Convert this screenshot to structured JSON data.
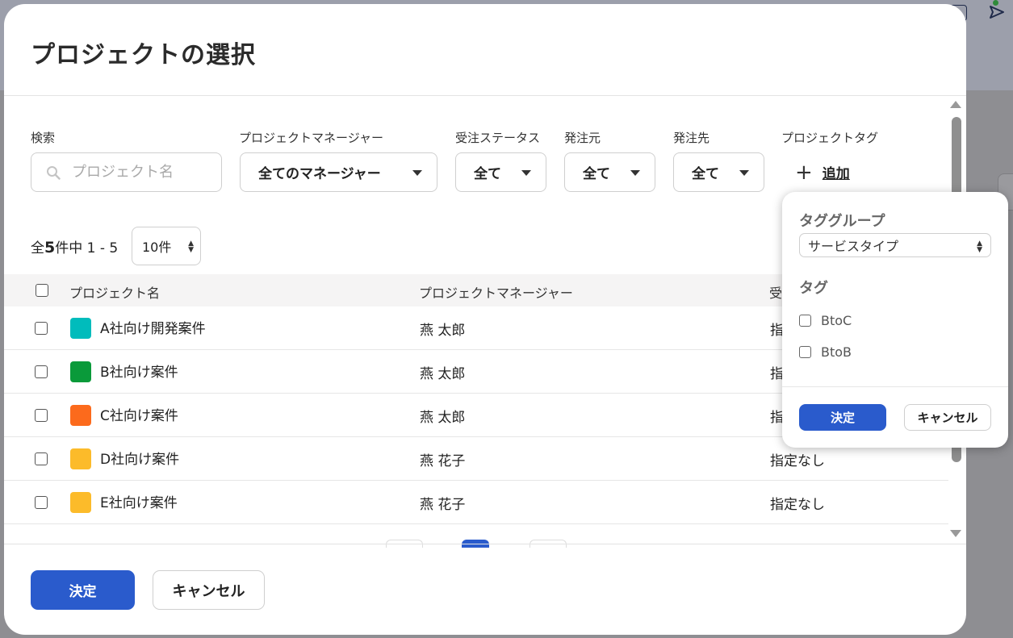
{
  "modal": {
    "title": "プロジェクトの選択"
  },
  "filters": {
    "search": {
      "label": "検索",
      "placeholder": "プロジェクト名",
      "value": ""
    },
    "manager": {
      "label": "プロジェクトマネージャー",
      "value": "全てのマネージャー"
    },
    "order_status": {
      "label": "受注ステータス",
      "value": "全て"
    },
    "client": {
      "label": "発注元",
      "value": "全て"
    },
    "vendor": {
      "label": "発注先",
      "value": "全て"
    },
    "project_tag": {
      "label": "プロジェクトタグ",
      "add_label": "追加"
    }
  },
  "summary": {
    "prefix": "全",
    "total": "5",
    "suffix": "件中 1 - 5",
    "per_page": "10件"
  },
  "table": {
    "headers": {
      "name": "プロジェクト名",
      "manager": "プロジェクトマネージャー",
      "status": "受"
    },
    "rows": [
      {
        "name": "A社向け開発案件",
        "manager": "燕 太郎",
        "status": "指",
        "color": "#00bcbc"
      },
      {
        "name": "B社向け案件",
        "manager": "燕 太郎",
        "status": "指",
        "color": "#0a9a3a"
      },
      {
        "name": "C社向け案件",
        "manager": "燕 太郎",
        "status": "指",
        "color": "#fc6a1c"
      },
      {
        "name": "D社向け案件",
        "manager": "燕 花子",
        "status": "指定なし",
        "color": "#fcbb2a"
      },
      {
        "name": "E社向け案件",
        "manager": "燕 花子",
        "status": "指定なし",
        "color": "#fcbb2a"
      }
    ]
  },
  "footer": {
    "confirm_label": "決定",
    "cancel_label": "キャンセル"
  },
  "tag_popover": {
    "group_title": "タググループ",
    "group_value": "サービスタイプ",
    "tag_title": "タグ",
    "options": [
      "BtoC",
      "BtoB"
    ],
    "confirm_label": "決定",
    "cancel_label": "キャンセル"
  },
  "colors": {
    "primary": "#2a5bcc",
    "overlay": "#8e8e92"
  }
}
